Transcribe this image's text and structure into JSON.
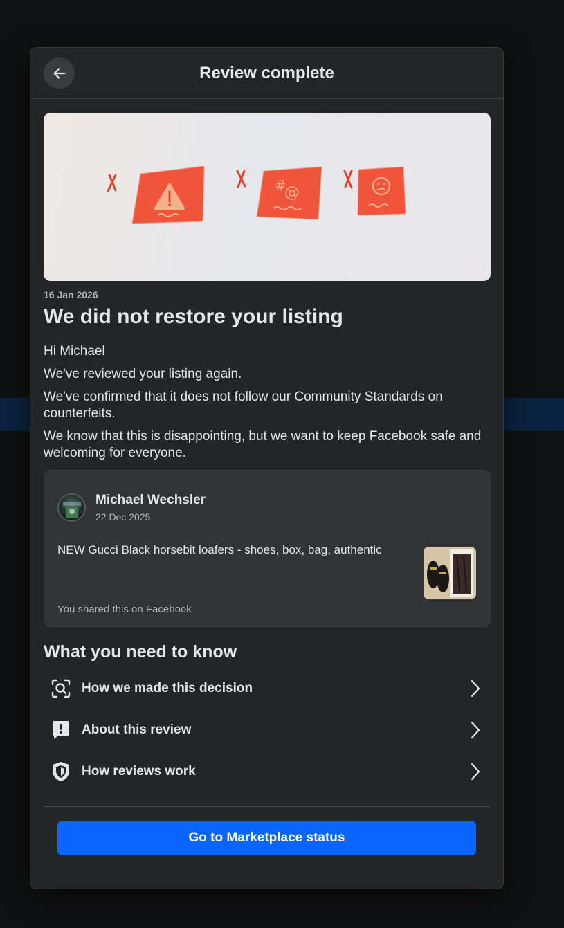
{
  "modal": {
    "title": "Review complete"
  },
  "notice": {
    "date": "16 Jan 2026",
    "headline": "We did not restore your listing",
    "paragraphs": [
      "Hi Michael",
      "We've reviewed your listing again.",
      "We've confirmed that it does not follow our Community Standards on counterfeits.",
      "We know that this is disappointing, but we want to keep Facebook safe and welcoming for everyone."
    ]
  },
  "post": {
    "author": "Michael Wechsler",
    "date": "22 Dec 2025",
    "text": "NEW Gucci Black horsebit loafers - shoes, box, bag, authentic",
    "shared_note": "You shared this on Facebook"
  },
  "info_section": {
    "title": "What you need to know",
    "items": [
      {
        "label": "How we made this decision",
        "icon": "search-magnifier-icon"
      },
      {
        "label": "About this review",
        "icon": "alert-speech-icon"
      },
      {
        "label": "How reviews work",
        "icon": "shield-icon"
      }
    ]
  },
  "actions": {
    "primary_label": "Go to Marketplace status"
  },
  "colors": {
    "modal_bg": "#242526",
    "card_bg": "#323334",
    "primary_button": "#0866ff",
    "text_primary": "#e4e6eb",
    "text_secondary": "#b0b3b8",
    "illustration_red": "#f0553a"
  }
}
